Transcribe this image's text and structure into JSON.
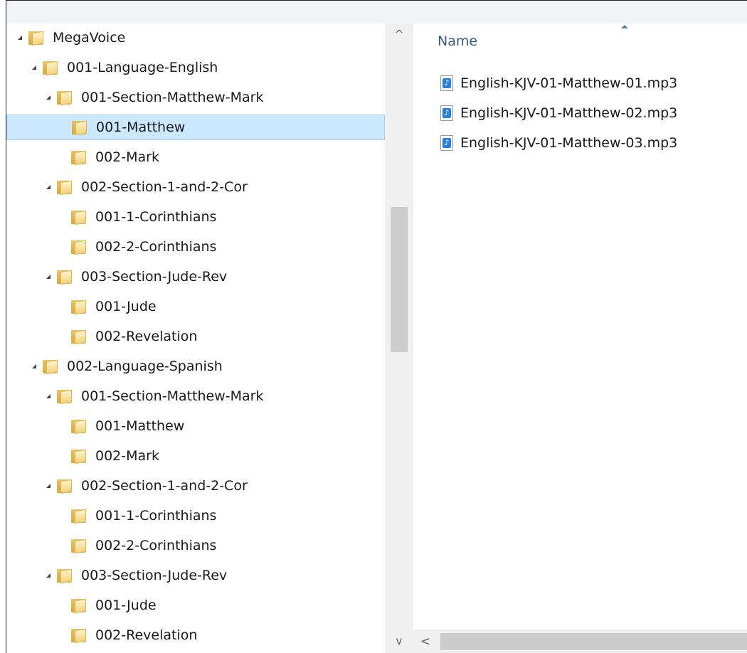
{
  "nav": {
    "items": [
      {
        "label": "MegaVoice",
        "level": 0,
        "expanded": true,
        "selected": false
      },
      {
        "label": "001-Language-English",
        "level": 1,
        "expanded": true,
        "selected": false
      },
      {
        "label": "001-Section-Matthew-Mark",
        "level": 2,
        "expanded": true,
        "selected": false
      },
      {
        "label": "001-Matthew",
        "level": 3,
        "expanded": false,
        "selected": true
      },
      {
        "label": "002-Mark",
        "level": 3,
        "expanded": false,
        "selected": false
      },
      {
        "label": "002-Section-1-and-2-Cor",
        "level": 2,
        "expanded": true,
        "selected": false
      },
      {
        "label": "001-1-Corinthians",
        "level": 3,
        "expanded": false,
        "selected": false
      },
      {
        "label": "002-2-Corinthians",
        "level": 3,
        "expanded": false,
        "selected": false
      },
      {
        "label": "003-Section-Jude-Rev",
        "level": 2,
        "expanded": true,
        "selected": false
      },
      {
        "label": "001-Jude",
        "level": 3,
        "expanded": false,
        "selected": false
      },
      {
        "label": "002-Revelation",
        "level": 3,
        "expanded": false,
        "selected": false
      },
      {
        "label": "002-Language-Spanish",
        "level": 1,
        "expanded": true,
        "selected": false
      },
      {
        "label": "001-Section-Matthew-Mark",
        "level": 2,
        "expanded": true,
        "selected": false
      },
      {
        "label": "001-Matthew",
        "level": 3,
        "expanded": false,
        "selected": false
      },
      {
        "label": "002-Mark",
        "level": 3,
        "expanded": false,
        "selected": false
      },
      {
        "label": "002-Section-1-and-2-Cor",
        "level": 2,
        "expanded": true,
        "selected": false
      },
      {
        "label": "001-1-Corinthians",
        "level": 3,
        "expanded": false,
        "selected": false
      },
      {
        "label": "002-2-Corinthians",
        "level": 3,
        "expanded": false,
        "selected": false
      },
      {
        "label": "003-Section-Jude-Rev",
        "level": 2,
        "expanded": true,
        "selected": false
      },
      {
        "label": "001-Jude",
        "level": 3,
        "expanded": false,
        "selected": false
      },
      {
        "label": "002-Revelation",
        "level": 3,
        "expanded": false,
        "selected": false
      }
    ]
  },
  "content": {
    "column_header": "Name",
    "sort": "ascending",
    "files": [
      {
        "name": "English-KJV-01-Matthew-01.mp3",
        "icon": "audio-file-icon"
      },
      {
        "name": "English-KJV-01-Matthew-02.mp3",
        "icon": "audio-file-icon"
      },
      {
        "name": "English-KJV-01-Matthew-03.mp3",
        "icon": "audio-file-icon"
      }
    ]
  },
  "scrollbars": {
    "vertical_up": "^",
    "vertical_down": "v",
    "horizontal_left": "<"
  },
  "colors": {
    "selection_bg": "#cce8ff",
    "selection_border": "#99d1ff",
    "header_text": "#3b5a80"
  }
}
